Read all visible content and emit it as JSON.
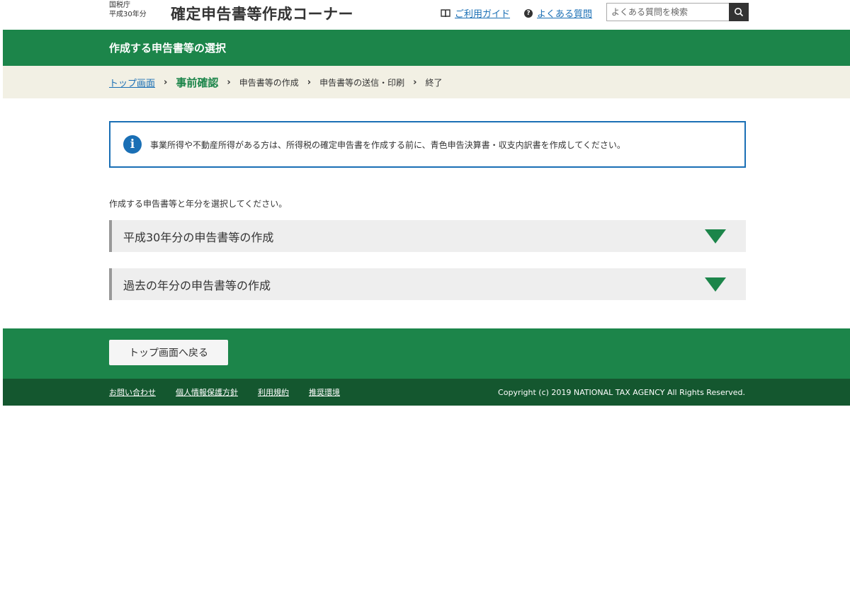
{
  "header": {
    "agency_line1": "国税庁",
    "agency_line2": "平成30年分",
    "app_title": "確定申告書等作成コーナー",
    "guide_link": "ご利用ガイド",
    "faq_link": "よくある質問",
    "search_placeholder": "よくある質問を検索",
    "icons": {
      "guide": "book-icon",
      "faq": "question-icon",
      "search": "search-icon"
    }
  },
  "page_title": "作成する申告書等の選択",
  "breadcrumb": {
    "items": [
      "トップ画面",
      "事前確認",
      "申告書等の作成",
      "申告書等の送信・印刷",
      "終了"
    ],
    "separator": "›"
  },
  "info": {
    "message": "事業所得や不動産所得がある方は、所得税の確定申告書を作成する前に、青色申告決算書・収支内訳書を作成してください。",
    "icon": "info-icon"
  },
  "instruction": "作成する申告書等と年分を選択してください。",
  "accordions": [
    {
      "label": "平成30年分の申告書等の作成"
    },
    {
      "label": "過去の年分の申告書等の作成"
    }
  ],
  "footer": {
    "back_button": "トップ画面へ戻る",
    "links": [
      "お問い合わせ",
      "個人情報保護方針",
      "利用規約",
      "推奨環境"
    ],
    "copyright": "Copyright (c) 2019 NATIONAL TAX AGENCY All Rights Reserved."
  },
  "colors": {
    "brand_green": "#1c854a",
    "dark_green": "#14572f",
    "link_blue": "#1a6fb5",
    "breadcrumb_bg": "#f2f0e4"
  }
}
